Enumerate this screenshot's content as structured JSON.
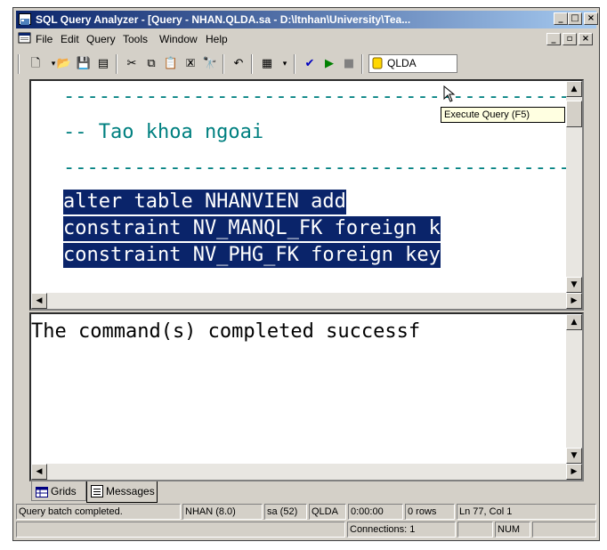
{
  "window": {
    "title": "SQL Query Analyzer - [Query - NHAN.QLDA.sa - D:\\ltnhan\\University\\Tea...",
    "caption_buttons": [
      "_",
      "□",
      "×"
    ],
    "mdi_buttons": [
      "_",
      "▫",
      "×"
    ]
  },
  "menu": [
    "File",
    "Edit",
    "Query",
    "Tools",
    "Window",
    "Help"
  ],
  "toolbar": {
    "database": "QLDA",
    "tooltip": "Execute Query (F5)"
  },
  "editor": {
    "lines": [
      "--------------------------------------------",
      "-- Tao khoa ngoai",
      "--------------------------------------------",
      "alter table NHANVIEN add",
      "constraint NV_MANQL_FK foreign k",
      "constraint NV_PHG_FK foreign key"
    ]
  },
  "results": {
    "message": "The command(s) completed successf"
  },
  "tabs": [
    "Grids",
    "Messages"
  ],
  "status": {
    "message": "Query batch completed.",
    "server": "NHAN (8.0)",
    "user": "sa (52)",
    "database": "QLDA",
    "time": "0:00:00",
    "rows": "0 rows",
    "position": "Ln 77, Col 1",
    "connections": "Connections: 1",
    "num": "NUM"
  },
  "colors": {
    "title_start": "#0a246a",
    "selection": "#0a246a",
    "comment": "#008080",
    "panel": "#d4d0c8"
  }
}
